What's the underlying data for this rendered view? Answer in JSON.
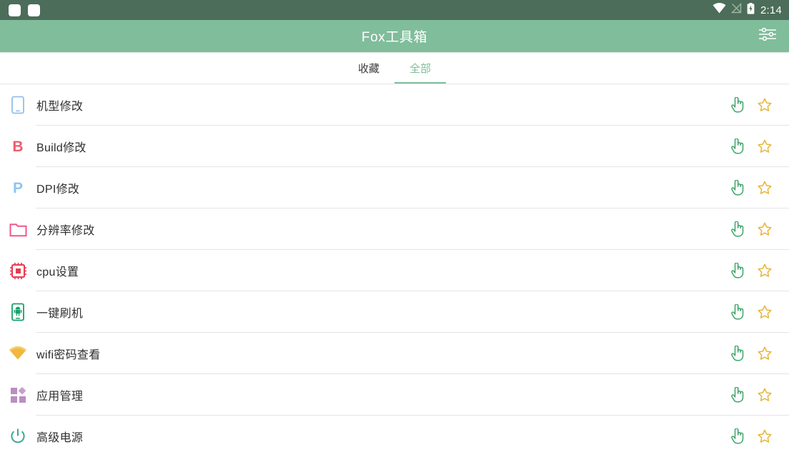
{
  "status_bar": {
    "notification_count": 2,
    "icons": [
      "wifi-icon",
      "signal-off-icon",
      "battery-charging-icon"
    ],
    "clock": "2:14",
    "background": "#4c6d59"
  },
  "app_bar": {
    "title": "Fox工具箱",
    "background": "#80bd9b",
    "action_icon": "tune-icon"
  },
  "tabs": {
    "items": [
      {
        "label": "收藏",
        "active": false
      },
      {
        "label": "全部",
        "active": true
      }
    ],
    "accent": "#80bd9b"
  },
  "row_actions": {
    "shortcut_label": "touch-app-icon",
    "favorite_label": "star-outline-icon",
    "shortcut_color": "#3fa56a",
    "favorite_color": "#e8b63c"
  },
  "list": {
    "items": [
      {
        "label": "机型修改",
        "icon": "phone-outline-icon",
        "color": "#90c0ea"
      },
      {
        "label": "Build修改",
        "icon": "letter-b-icon",
        "color": "#ef5a6d"
      },
      {
        "label": "DPI修改",
        "icon": "letter-p-icon",
        "color": "#8ec5f0"
      },
      {
        "label": "分辨率修改",
        "icon": "folder-outline-icon",
        "color": "#f2568c"
      },
      {
        "label": "cpu设置",
        "icon": "cpu-chip-icon",
        "color": "#e8394f"
      },
      {
        "label": "一键刷机",
        "icon": "phone-android-flash-icon",
        "color": "#17a06a"
      },
      {
        "label": "wifi密码查看",
        "icon": "wifi-icon",
        "color": "#f0b93c"
      },
      {
        "label": "应用管理",
        "icon": "apps-grid-icon",
        "color": "#b98ec0"
      },
      {
        "label": "高级电源",
        "icon": "power-icon",
        "color": "#3aa891"
      }
    ]
  }
}
